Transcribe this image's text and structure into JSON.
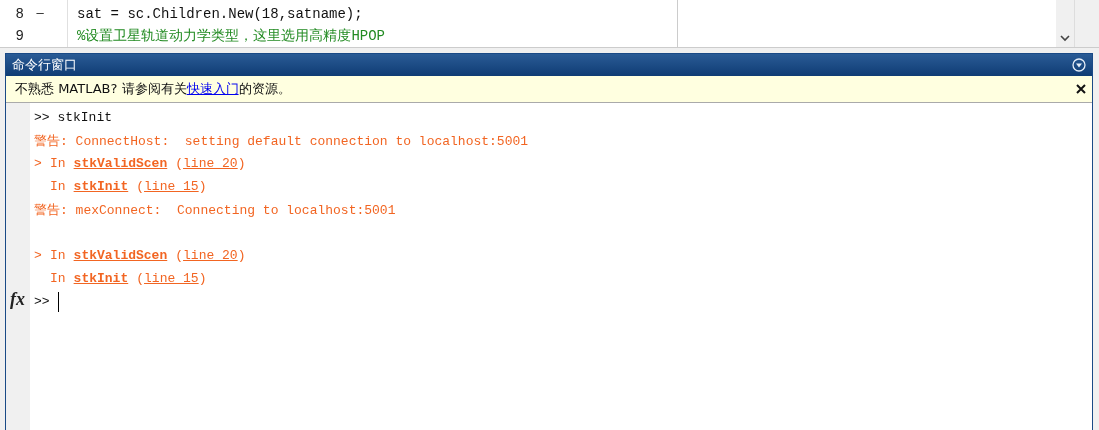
{
  "editor": {
    "lines": [
      {
        "number": "8",
        "marker": "—",
        "kind": "code",
        "text": "sat = sc.Children.New(18,satname);"
      },
      {
        "number": "9",
        "kind": "comment",
        "text": "%设置卫星轨道动力学类型，这里选用高精度HPOP"
      }
    ]
  },
  "command_window": {
    "title": "命令行窗口",
    "notice": {
      "prefix": "不熟悉 MATLAB? 请参阅有关",
      "link": "快速入门",
      "suffix": "的资源。"
    },
    "function_button": "fx",
    "lines": [
      {
        "kind": "input",
        "prompt": ">>",
        "text": "stkInit"
      },
      {
        "kind": "warning",
        "label": "警告:",
        "text": "ConnectHost:  setting default connection to localhost:5001"
      },
      {
        "kind": "trace",
        "arrow": ">",
        "word": "In",
        "func": "stkValidScen",
        "open": "(",
        "link": "line 20",
        "close": ")"
      },
      {
        "kind": "trace",
        "word": "In",
        "func": "stkInit",
        "open": "(",
        "link": "line 15",
        "close": ")"
      },
      {
        "kind": "warning",
        "label": "警告:",
        "text": "mexConnect:  Connecting to localhost:5001"
      },
      {
        "kind": "blank"
      },
      {
        "kind": "trace",
        "arrow": ">",
        "word": "In",
        "func": "stkValidScen",
        "open": "(",
        "link": "line 20",
        "close": ")"
      },
      {
        "kind": "trace",
        "word": "In",
        "func": "stkInit",
        "open": "(",
        "link": "line 15",
        "close": ")"
      },
      {
        "kind": "prompt",
        "prompt": ">>"
      }
    ]
  }
}
